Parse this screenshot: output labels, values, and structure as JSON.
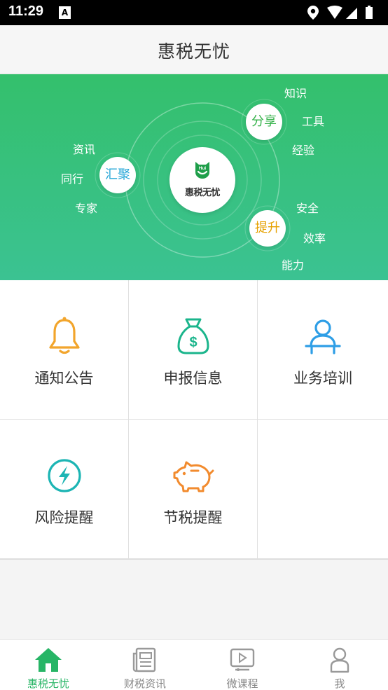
{
  "status_bar": {
    "time": "11:29",
    "notification_glyph": "A"
  },
  "header": {
    "title": "惠税无忧"
  },
  "banner": {
    "logo_text": "惠税无忧",
    "logo_mark": "Hui",
    "circles": {
      "gather": "汇聚",
      "share": "分享",
      "improve": "提升"
    },
    "gather_words": [
      "资讯",
      "同行",
      "专家"
    ],
    "share_words": [
      "知识",
      "工具",
      "经验"
    ],
    "improve_words": [
      "安全",
      "效率",
      "能力"
    ],
    "colors": {
      "gather": "#2aa8d8",
      "share": "#35b24a",
      "improve": "#e6a100"
    }
  },
  "menu": [
    {
      "label": "通知公告",
      "icon": "bell-icon",
      "color": "#f2a52c"
    },
    {
      "label": "申报信息",
      "icon": "money-bag-icon",
      "color": "#1bb58c"
    },
    {
      "label": "业务培训",
      "icon": "trainer-icon",
      "color": "#2e9ee6"
    },
    {
      "label": "风险提醒",
      "icon": "lightning-icon",
      "color": "#1db5b4"
    },
    {
      "label": "节税提醒",
      "icon": "piggy-bank-icon",
      "color": "#f28b2e"
    }
  ],
  "nav": [
    {
      "label": "惠税无忧",
      "icon": "home-icon",
      "active": true
    },
    {
      "label": "财税资讯",
      "icon": "news-icon",
      "active": false
    },
    {
      "label": "微课程",
      "icon": "video-icon",
      "active": false
    },
    {
      "label": "我",
      "icon": "profile-icon",
      "active": false
    }
  ],
  "colors": {
    "accent": "#27b566",
    "inactive": "#888888"
  }
}
